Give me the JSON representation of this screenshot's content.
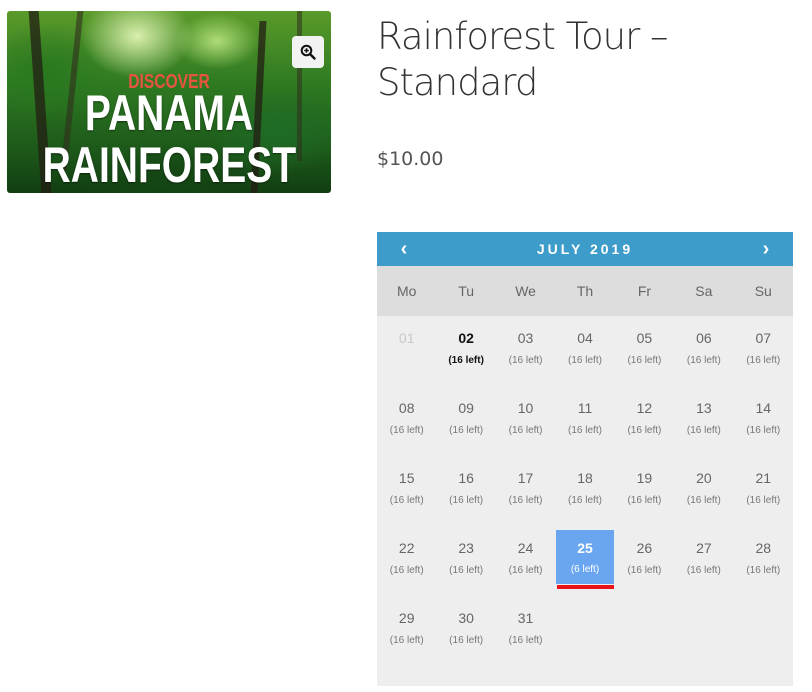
{
  "product": {
    "image": {
      "line1": "DISCOVER",
      "line2": "PANAMA",
      "line3": "RAINFOREST",
      "zoom_icon": "zoom-in-icon"
    },
    "title": "Rainforest Tour – Standard",
    "price": "$10.00"
  },
  "calendar": {
    "month_label": "JULY 2019",
    "prev": "‹",
    "next": "›",
    "weekdays": [
      "Mo",
      "Tu",
      "We",
      "Th",
      "Fr",
      "Sa",
      "Su"
    ],
    "days": [
      {
        "num": "01",
        "left": "",
        "state": "disabled"
      },
      {
        "num": "02",
        "left": "(16 left)",
        "state": "today"
      },
      {
        "num": "03",
        "left": "(16 left)",
        "state": "available"
      },
      {
        "num": "04",
        "left": "(16 left)",
        "state": "available"
      },
      {
        "num": "05",
        "left": "(16 left)",
        "state": "available"
      },
      {
        "num": "06",
        "left": "(16 left)",
        "state": "available"
      },
      {
        "num": "07",
        "left": "(16 left)",
        "state": "available"
      },
      {
        "num": "08",
        "left": "(16 left)",
        "state": "available"
      },
      {
        "num": "09",
        "left": "(16 left)",
        "state": "available"
      },
      {
        "num": "10",
        "left": "(16 left)",
        "state": "available"
      },
      {
        "num": "11",
        "left": "(16 left)",
        "state": "available"
      },
      {
        "num": "12",
        "left": "(16 left)",
        "state": "available"
      },
      {
        "num": "13",
        "left": "(16 left)",
        "state": "available"
      },
      {
        "num": "14",
        "left": "(16 left)",
        "state": "available"
      },
      {
        "num": "15",
        "left": "(16 left)",
        "state": "available"
      },
      {
        "num": "16",
        "left": "(16 left)",
        "state": "available"
      },
      {
        "num": "17",
        "left": "(16 left)",
        "state": "available"
      },
      {
        "num": "18",
        "left": "(16 left)",
        "state": "available"
      },
      {
        "num": "19",
        "left": "(16 left)",
        "state": "available"
      },
      {
        "num": "20",
        "left": "(16 left)",
        "state": "available"
      },
      {
        "num": "21",
        "left": "(16 left)",
        "state": "available"
      },
      {
        "num": "22",
        "left": "(16 left)",
        "state": "available"
      },
      {
        "num": "23",
        "left": "(16 left)",
        "state": "available"
      },
      {
        "num": "24",
        "left": "(16 left)",
        "state": "available"
      },
      {
        "num": "25",
        "left": "(6 left)",
        "state": "selected"
      },
      {
        "num": "26",
        "left": "(16 left)",
        "state": "available"
      },
      {
        "num": "27",
        "left": "(16 left)",
        "state": "available"
      },
      {
        "num": "28",
        "left": "(16 left)",
        "state": "available"
      },
      {
        "num": "29",
        "left": "(16 left)",
        "state": "available"
      },
      {
        "num": "30",
        "left": "(16 left)",
        "state": "available"
      },
      {
        "num": "31",
        "left": "(16 left)",
        "state": "available"
      }
    ]
  },
  "colors": {
    "header": "#3d9cc9",
    "selected": "#6aa6f0",
    "highlight_underline": "#e8121a"
  }
}
